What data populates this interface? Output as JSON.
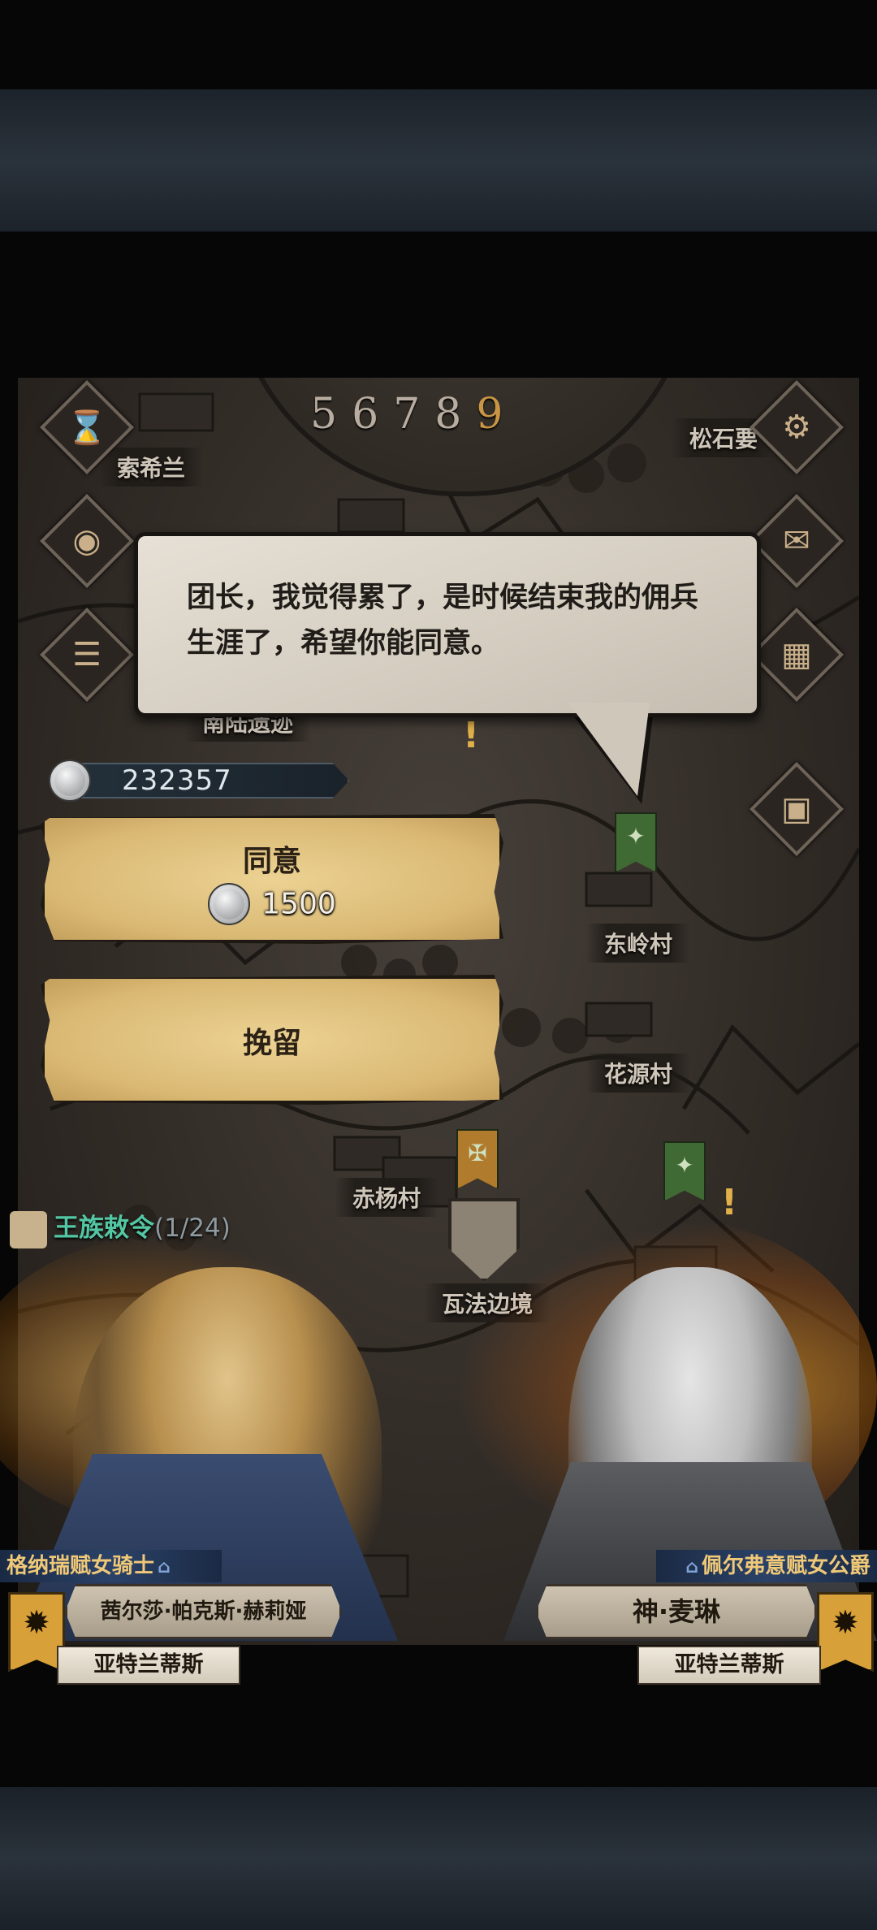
{
  "map": {
    "clock_numbers": [
      "5",
      "6",
      "7",
      "8"
    ],
    "clock_highlight": "9",
    "places": [
      "索希兰",
      "松石要",
      "南陆遗迹",
      "东岭村",
      "花源村",
      "赤杨村",
      "瓦法边境"
    ],
    "icons": [
      "hourglass-icon",
      "gear-icon",
      "money-bag-icon",
      "letter-icon",
      "scroll-icon",
      "building-icon",
      "supply-crate-icon"
    ]
  },
  "dialog": {
    "speech": "团长，我觉得累了，是时候结束我的佣兵生涯了，希望你能同意。"
  },
  "currency": {
    "silver": "232357"
  },
  "choices": {
    "agree_label": "同意",
    "agree_cost": "1500",
    "retain_label": "挽留"
  },
  "decree": {
    "label": "王族敕令",
    "count": "(1/24)"
  },
  "left_character": {
    "title": "格纳瑞赋女骑士",
    "name": "茜尔莎·帕克斯·赫莉娅",
    "nation": "亚特兰蒂斯"
  },
  "right_character": {
    "title": "佩尔弗意赋女公爵",
    "name": "神·麦琳",
    "nation": "亚特兰蒂斯"
  },
  "colors": {
    "decree_text": "#53c7a4",
    "title_gold": "#efc878",
    "button_parchment": "#e3c782"
  }
}
